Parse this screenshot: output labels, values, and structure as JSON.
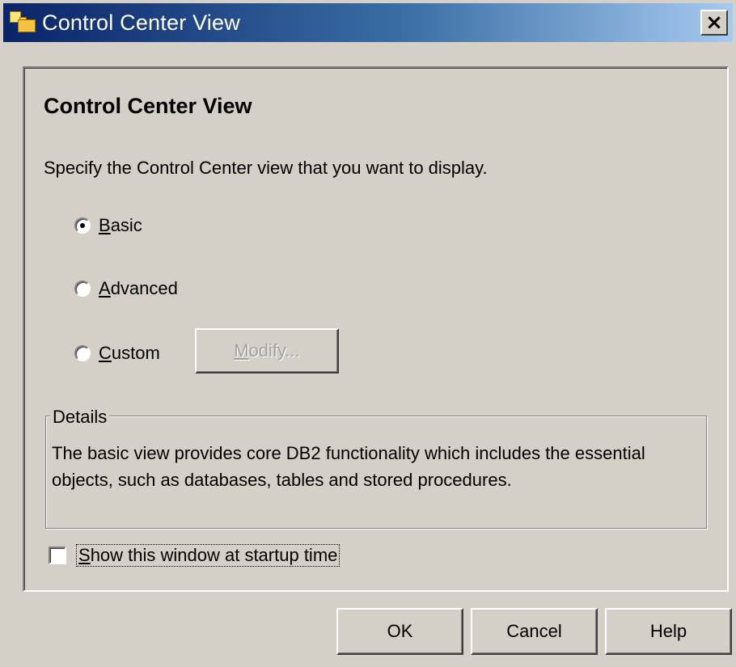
{
  "window": {
    "title": "Control Center View",
    "close_label": "×"
  },
  "content": {
    "heading": "Control Center View",
    "instruction": "Specify the Control Center view that you want to display.",
    "options": [
      {
        "mnemonic": "B",
        "rest": "asic",
        "selected": true
      },
      {
        "mnemonic": "A",
        "rest": "dvanced",
        "selected": false
      },
      {
        "mnemonic": "C",
        "rest": "ustom",
        "selected": false
      }
    ],
    "modify_button": {
      "mnemonic": "M",
      "rest": "odify...",
      "enabled": false
    },
    "details": {
      "label": "Details",
      "text": "The basic view provides core DB2 functionality which includes the essential objects, such as databases, tables and stored procedures."
    },
    "startup_checkbox": {
      "mnemonic": "S",
      "rest": "how this window at startup time",
      "checked": false
    }
  },
  "buttons": {
    "ok": "OK",
    "cancel": "Cancel",
    "help": "Help"
  }
}
